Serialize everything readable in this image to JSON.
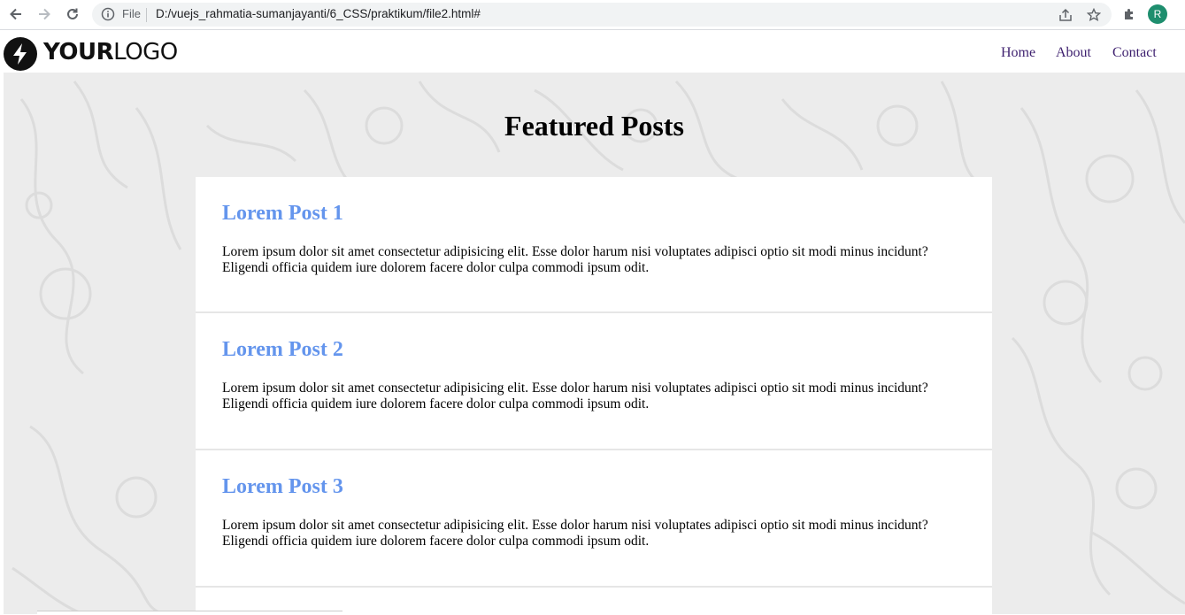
{
  "browser": {
    "url_scheme_label": "File",
    "url": "D:/vuejs_rahmatia-sumanjayanti/6_CSS/praktikum/file2.html#",
    "profile_initial": "R",
    "icons": [
      "back-arrow-icon",
      "forward-arrow-icon",
      "reload-icon",
      "info-icon",
      "share-icon",
      "star-icon",
      "extensions-icon"
    ]
  },
  "header": {
    "logo_bold": "YOUR",
    "logo_light": "LOGO",
    "nav": [
      "Home",
      "About",
      "Contact"
    ]
  },
  "main": {
    "title": "Featured Posts",
    "posts": [
      {
        "title": "Lorem Post 1",
        "body": "Lorem ipsum dolor sit amet consectetur adipisicing elit. Esse dolor harum nisi voluptates adipisci optio sit modi minus incidunt? Eligendi officia quidem iure dolorem facere dolor culpa commodi ipsum odit."
      },
      {
        "title": "Lorem Post 2",
        "body": "Lorem ipsum dolor sit amet consectetur adipisicing elit. Esse dolor harum nisi voluptates adipisci optio sit modi minus incidunt? Eligendi officia quidem iure dolorem facere dolor culpa commodi ipsum odit."
      },
      {
        "title": "Lorem Post 3",
        "body": "Lorem ipsum dolor sit amet consectetur adipisicing elit. Esse dolor harum nisi voluptates adipisci optio sit modi minus incidunt? Eligendi officia quidem iure dolorem facere dolor culpa commodi ipsum odit."
      }
    ]
  },
  "colors": {
    "post_title": "#6495ed",
    "nav_link": "#3d1f6e",
    "page_background": "#ececec",
    "avatar": "#1e8e6e"
  }
}
